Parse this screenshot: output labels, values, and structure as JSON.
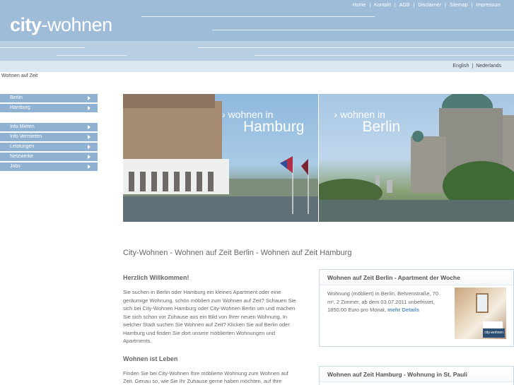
{
  "brand": {
    "logo_bold": "city",
    "logo_rest": "-wohnen"
  },
  "topnav": [
    "Home",
    "Kontakt",
    "AGB",
    "Disclaimer",
    "Sitemap",
    "Impressum"
  ],
  "languages": [
    "English",
    "Nederlands"
  ],
  "breadcrumb": "Wohnen auf Zeit",
  "sidebar": {
    "group1": [
      "Berlin",
      "Hamburg"
    ],
    "group2": [
      "Info Mieten",
      "Info Vermieten",
      "Leistungen",
      "Netzwerke",
      "Jobs"
    ]
  },
  "hero": {
    "hamburg": {
      "line1": "wohnen in",
      "line2": "Hamburg"
    },
    "berlin": {
      "line1": "wohnen in",
      "line2": "Berlin"
    }
  },
  "main_title": "City-Wohnen - Wohnen auf Zeit Berlin - Wohnen auf Zeit Hamburg",
  "welcome": {
    "heading": "Herzlich Willkommen!",
    "text": "Sie suchen in Berlin oder Hamburg ein kleines Apartment oder eine geräumige Wohnung, schön möbliert zum Wohnen auf Zeit? Schauen Sie sich bei City-Wohnen Hamburg oder City-Wohnen Berlin um und machen Sie sich schon vor Zuhause aus ein Bild von Ihrer neuen Wohnung. In welcher Stadt suchen Sie Wohnen auf Zeit? Klicken Sie auf Berlin oder Hamburg und finden Sie dort unsere möblierten Wohnungen und Apartments."
  },
  "living": {
    "heading": "Wohnen ist Leben",
    "text": "Finden Sie bei City-Wohnen Ihre möblierte Wohnung zum Wohnen auf Zeit. Genau so, wie Sie Ihr Zuhause gerne haben möchten, auf Ihre"
  },
  "box_berlin": {
    "title": "Wohnen auf Zeit Berlin - Apartment der Woche",
    "text": "Wohnung (möbliert) in Berlin, Behrenstraße, 70 m², 2 Zimmer, ab dem 03.07.2011 unbefristet, 1850.00 Euro pro Monat,",
    "more": "mehr Details",
    "thumb_tag": "city-wohnen"
  },
  "box_hamburg": {
    "title": "Wohnen auf Zeit Hamburg - Wohnung in St. Pauli"
  },
  "colors": {
    "header": "#9ebcd8",
    "sidebar": "#8fb2d3",
    "link": "#5a8fc0"
  }
}
